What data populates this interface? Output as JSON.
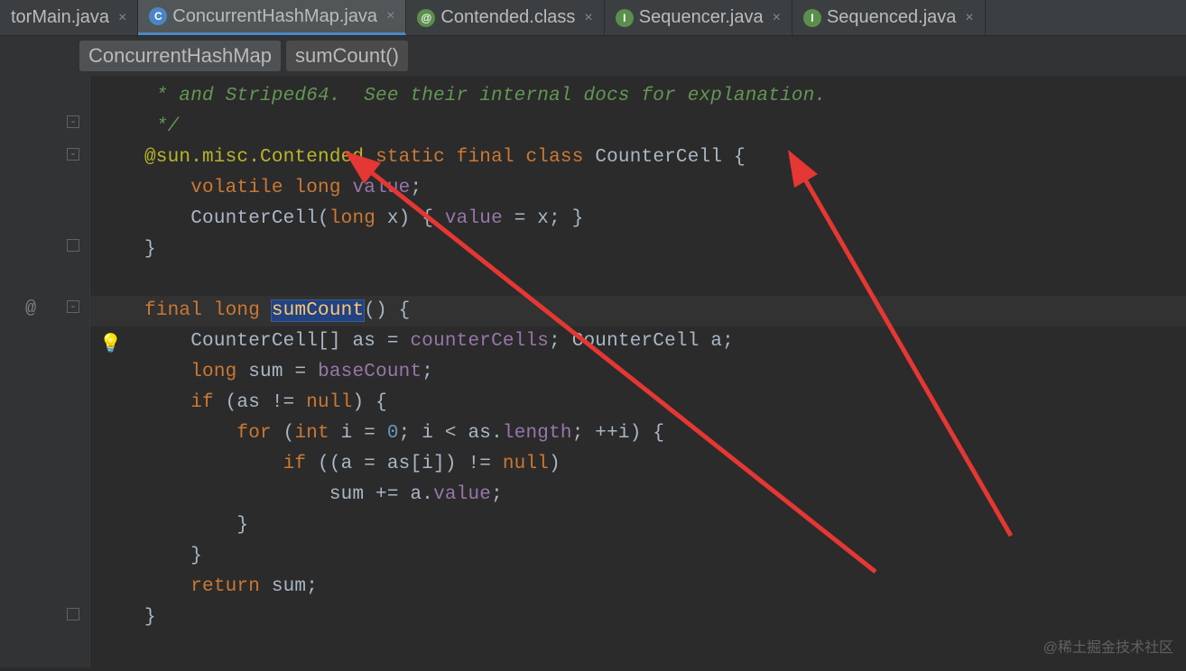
{
  "tabs": [
    {
      "label": "torMain.java",
      "icon": ""
    },
    {
      "label": "ConcurrentHashMap.java",
      "icon": "C"
    },
    {
      "label": "Contended.class",
      "icon": "@"
    },
    {
      "label": "Sequencer.java",
      "icon": "I"
    },
    {
      "label": "Sequenced.java",
      "icon": "I"
    }
  ],
  "breadcrumb": {
    "class": "ConcurrentHashMap",
    "method": "sumCount()"
  },
  "code": {
    "l1": " * and Striped64.  See their internal docs for explanation.",
    "l2": " */",
    "l3_anno": "@sun.misc.Contended",
    "l3_kw": "static final class",
    "l3_cls": "CounterCell",
    "l3_tail": " {",
    "l4_kw": "volatile long",
    "l4_field": "value",
    "l4_tail": ";",
    "l5_a": "CounterCell(",
    "l5_kw": "long",
    "l5_b": " x) { ",
    "l5_field": "value",
    "l5_c": " = x; }",
    "l6": "}",
    "l8_kw": "final long",
    "l8_method": "sumCount",
    "l8_tail": "() {",
    "l9_a": "CounterCell[] as = ",
    "l9_field": "counterCells",
    "l9_b": "; CounterCell a;",
    "l10_kw": "long",
    "l10_a": " sum = ",
    "l10_field": "baseCount",
    "l10_b": ";",
    "l11_kw": "if",
    "l11_a": " (as != ",
    "l11_kw2": "null",
    "l11_b": ") {",
    "l12_kw": "for",
    "l12_a": " (",
    "l12_kw2": "int",
    "l12_b": " i = ",
    "l12_num": "0",
    "l12_c": "; i < as.",
    "l12_field": "length",
    "l12_d": "; ++i) {",
    "l13_kw": "if",
    "l13_a": " ((a = as[i]) != ",
    "l13_kw2": "null",
    "l13_b": ")",
    "l14_a": "sum += a.",
    "l14_field": "value",
    "l14_b": ";",
    "l15": "}",
    "l16": "}",
    "l17_kw": "return",
    "l17_a": " sum;",
    "l18": "}"
  },
  "watermark": "@稀土掘金技术社区"
}
